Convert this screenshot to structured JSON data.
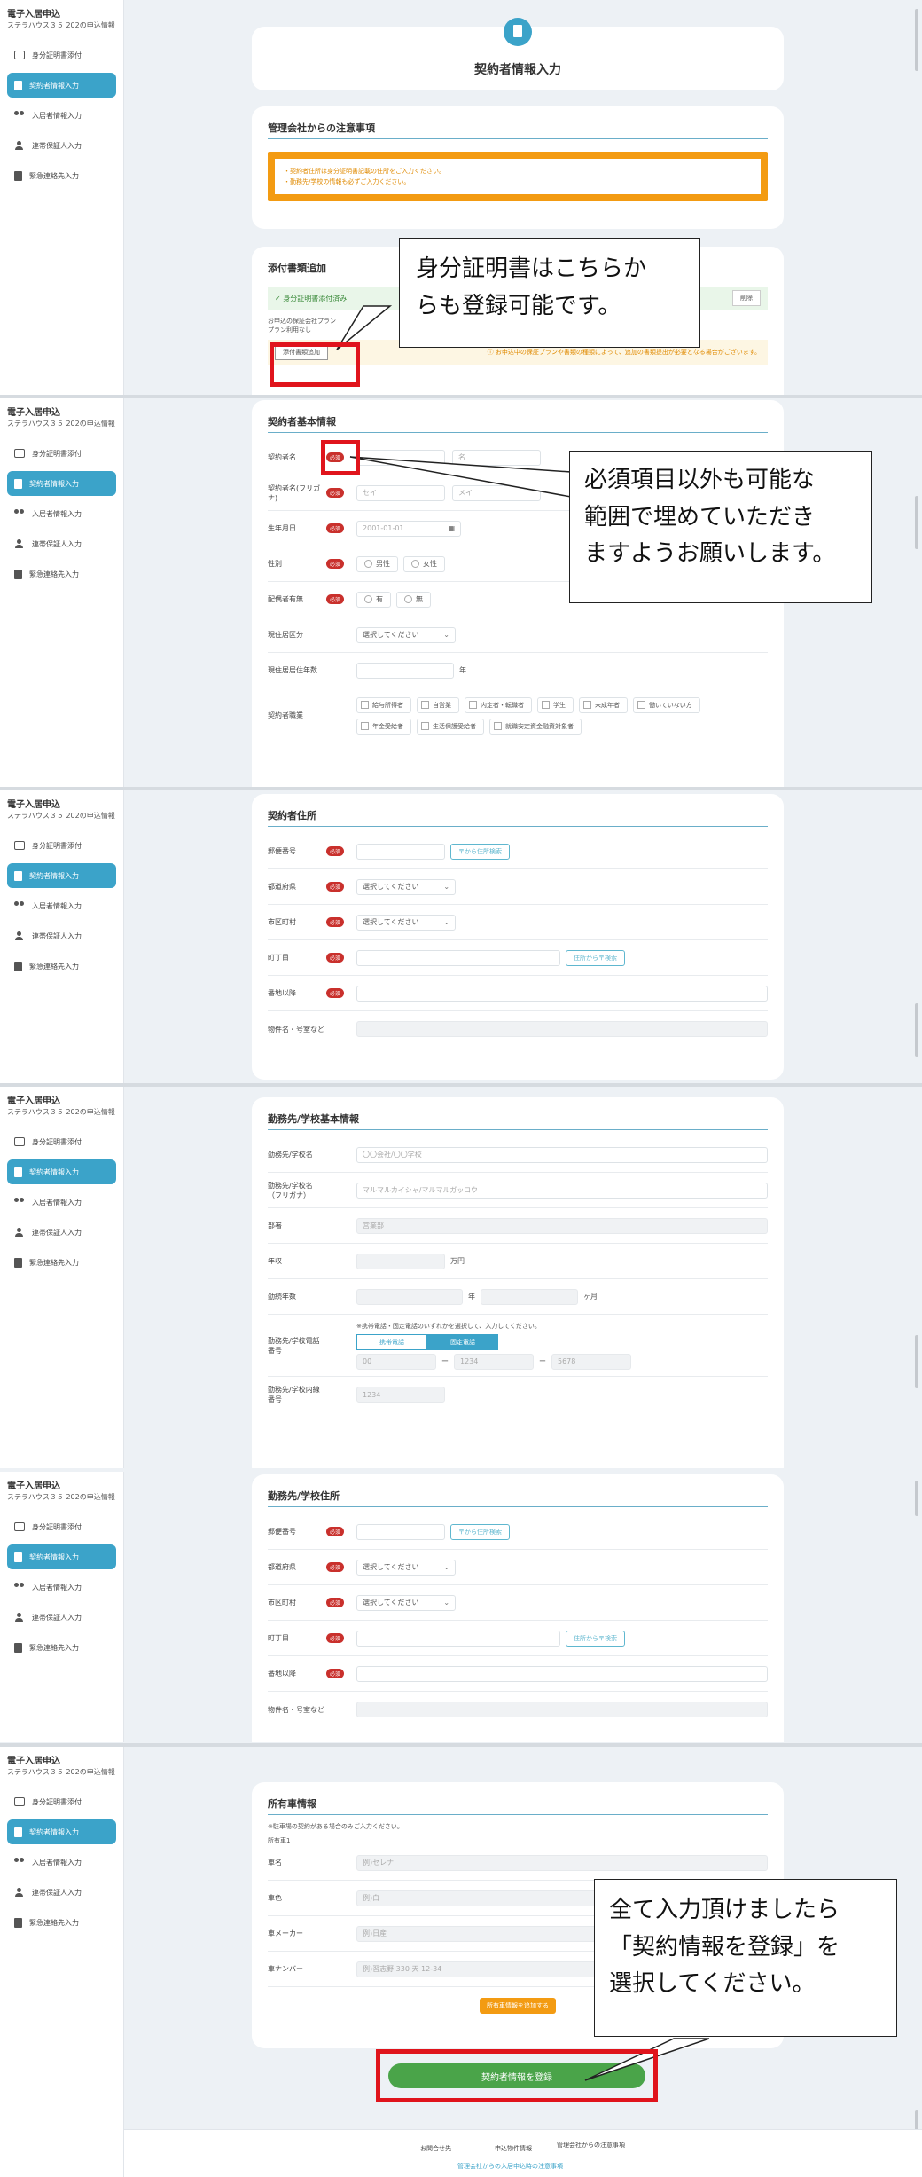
{
  "sidebar": {
    "title": "電子入居申込",
    "subtitle": "ステラハウス３５ 202の申込情報",
    "items": [
      {
        "label": "身分証明書添付",
        "icon": "id-card-icon"
      },
      {
        "label": "契約者情報入力",
        "icon": "document-icon"
      },
      {
        "label": "入居者情報入力",
        "icon": "users-icon"
      },
      {
        "label": "連帯保証人入力",
        "icon": "user-icon"
      },
      {
        "label": "緊急連絡先入力",
        "icon": "book-icon"
      }
    ]
  },
  "header": {
    "title": "契約者情報入力"
  },
  "notice": {
    "title": "管理会社からの注意事項",
    "lines": [
      "・契約者住所は身分証明書記載の住所をご入力ください。",
      "・勤務先/学校の情報も必ずご入力ください。"
    ]
  },
  "attach": {
    "title": "添付書類追加",
    "success": "✓ 身分証明書添付済み",
    "delete": "削除",
    "plan_label": "お申込の保証会社プラン",
    "plan_value": "プラン利用なし",
    "button": "添付書類追加",
    "warning": "ⓘ お申込中の保証プランや書類の種類によって、追加の書類提出が必要となる場合がございます。"
  },
  "callouts": {
    "id_upload": [
      "身分証明書はこちらか",
      "らも登録可能です。"
    ],
    "optional": [
      "必須項目以外も可能な",
      "範囲で埋めていただき",
      "ますようお願いします。"
    ],
    "submit": [
      "全て入力頂けましたら",
      "「契約情報を登録」を",
      "選択してください。"
    ]
  },
  "basic": {
    "title": "契約者基本情報",
    "required": "必須",
    "name_label": "契約者名",
    "first_placeholder": "名",
    "kana_label": "契約者名(フリガナ)",
    "sei": "セイ",
    "mei": "メイ",
    "birth_label": "生年月日",
    "birth_placeholder": "2001-01-01",
    "gender_label": "性別",
    "male": "男性",
    "female": "女性",
    "spouse_label": "配偶者有無",
    "yes": "有",
    "no": "無",
    "residence_label": "現住居区分",
    "select": "選択してください",
    "years_label": "現住居居住年数",
    "years_unit": "年",
    "job_label": "契約者職業",
    "jobs": [
      "給与所得者",
      "自営業",
      "内定者・転職者",
      "学生",
      "未成年者",
      "働いていない方",
      "年金受給者",
      "生活保護受給者",
      "就職安定資金融資対象者"
    ]
  },
  "address": {
    "title": "契約者住所",
    "zip_label": "郵便番号",
    "zip_button": "〒から住所検索",
    "pref_label": "都道府県",
    "city_label": "市区町村",
    "town_label": "町丁目",
    "town_button": "住所から〒検索",
    "street_label": "番地以降",
    "building_label": "物件名・号室など"
  },
  "work": {
    "title": "勤務先/学校基本情報",
    "name_label": "勤務先/学校名",
    "name_placeholder": "〇〇会社/〇〇学校",
    "kana_label": "勤務先/学校名（フリガナ）",
    "kana_placeholder": "マルマルカイシャ/マルマルガッコウ",
    "dept_label": "部署",
    "dept_placeholder": "営業部",
    "income_label": "年収",
    "income_unit": "万円",
    "tenure_label": "勤続年数",
    "tenure_year": "年",
    "tenure_month": "ヶ月",
    "phone_note": "※携帯電話・固定電話のいずれかを選択して、入力してください。",
    "phone_label": "勤務先/学校電話番号",
    "tab_mobile": "携帯電話",
    "tab_fixed": "固定電話",
    "phone_1": "00",
    "phone_2": "1234",
    "phone_3": "5678",
    "dash": "ー",
    "ext_label": "勤務先/学校内線番号",
    "ext_placeholder": "1234"
  },
  "work_address": {
    "title": "勤務先/学校住所"
  },
  "owner": {
    "title": "所有車情報",
    "note": "※駐車場の契約がある場合のみご入力ください。",
    "sub": "所有車1",
    "rows": [
      {
        "label": "車名",
        "placeholder": "例)セレナ"
      },
      {
        "label": "車色",
        "placeholder": "例)白"
      },
      {
        "label": "車メーカー",
        "placeholder": "例)日産"
      },
      {
        "label": "車ナンバー",
        "placeholder": "例)習志野 330 天 12-34"
      }
    ],
    "add_button": "所有車情報を追加する"
  },
  "submit": {
    "label": "契約者情報を登録"
  },
  "footer": {
    "links": [
      "お問合せ先",
      "申込物件情報",
      "管理会社からの注意事項"
    ],
    "blue": "管理会社からの入居申込時の注意事項"
  }
}
